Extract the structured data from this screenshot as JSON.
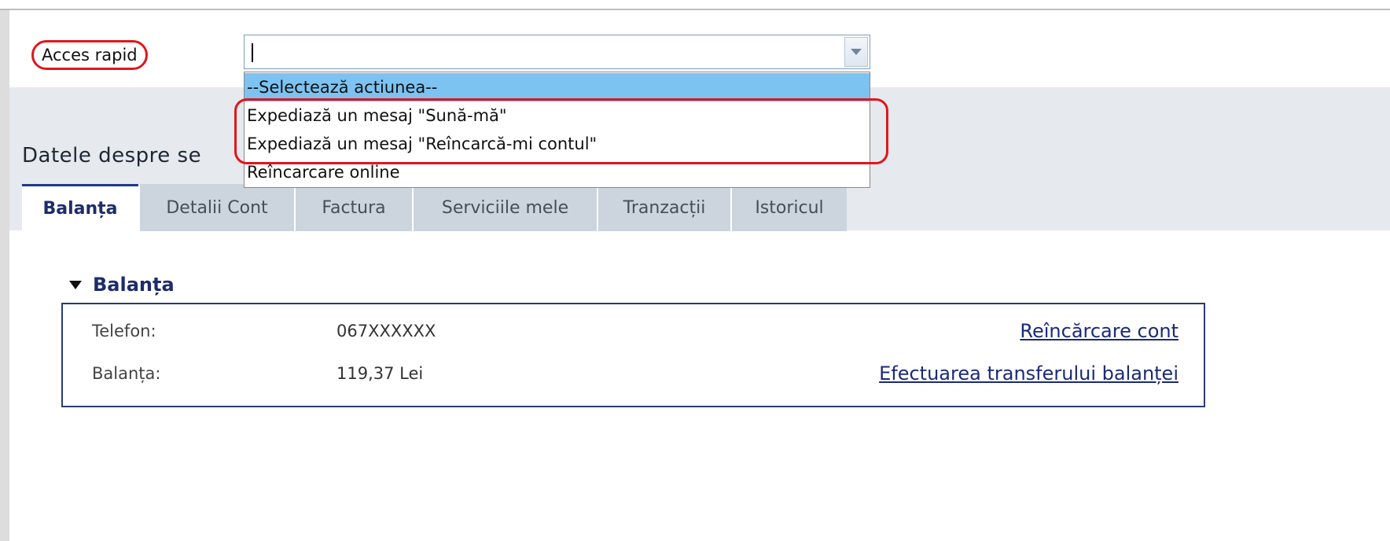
{
  "quick_access": {
    "label": "Acces rapid",
    "combo_value": "",
    "options": [
      "--Selectează actiunea--",
      "Expediază un mesaj \"Sună-mă\"",
      "Expediază un mesaj \"Reîncarcă-mi contul\"",
      "Reîncarcare online"
    ],
    "selected_index": 0
  },
  "section": {
    "title": "Datele despre se"
  },
  "tabs": [
    "Balanța",
    "Detalii Cont",
    "Factura",
    "Serviciile mele",
    "Tranzacții",
    "Istoricul"
  ],
  "balance": {
    "title": "Balanța",
    "rows": [
      {
        "label": "Telefon:",
        "value": "067XXXXXX",
        "link": "Reîncărcare cont"
      },
      {
        "label": "Balanța:",
        "value": "119,37 Lei",
        "link": "Efectuarea transferului balanței"
      }
    ]
  },
  "colors": {
    "accent": "#1e2c6b",
    "highlight": "#e0161c",
    "selected_option": "#7cc3f2",
    "tab_inactive": "#ccd4de"
  },
  "icons": {
    "combo_button": "chevron-down-icon",
    "section_toggle": "caret-down-icon"
  }
}
